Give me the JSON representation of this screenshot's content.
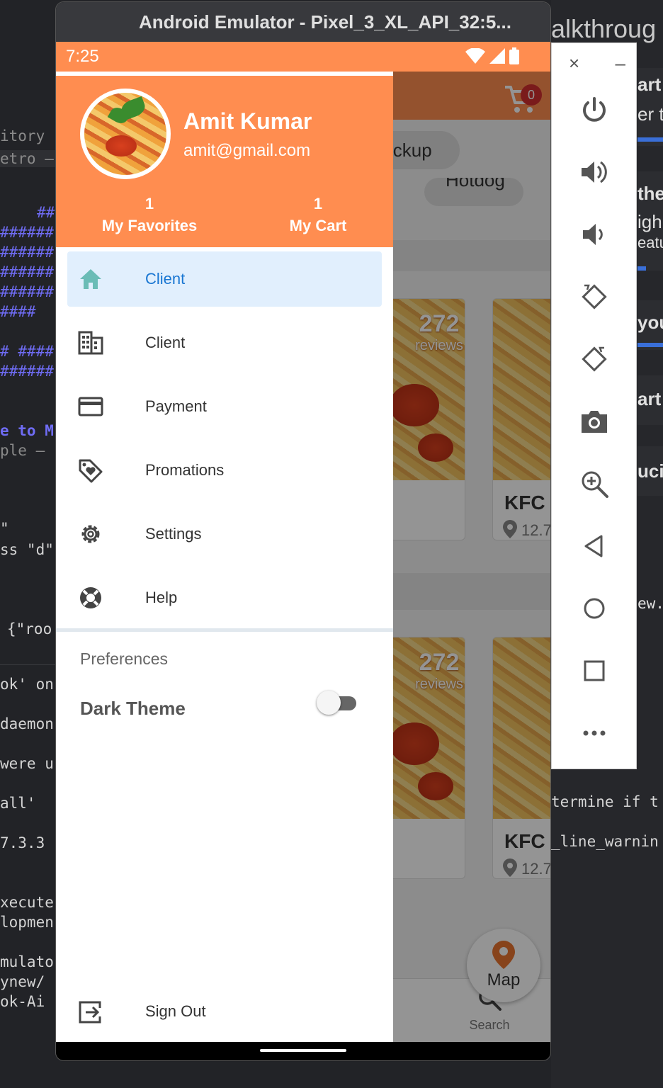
{
  "emulator": {
    "title": "Android Emulator - Pixel_3_XL_API_32:5..."
  },
  "status_bar": {
    "time": "7:25"
  },
  "drawer": {
    "user_name": "Amit Kumar",
    "user_email": "amit@gmail.com",
    "favorites_count": "1",
    "favorites_label": "My Favorites",
    "cart_count": "1",
    "cart_label": "My Cart",
    "items": [
      {
        "label": "Client",
        "icon": "home-icon",
        "active": true
      },
      {
        "label": "Client",
        "icon": "building-icon",
        "active": false
      },
      {
        "label": "Payment",
        "icon": "credit-card-icon",
        "active": false
      },
      {
        "label": "Promations",
        "icon": "tag-heart-icon",
        "active": false
      },
      {
        "label": "Settings",
        "icon": "gear-icon",
        "active": false
      },
      {
        "label": "Help",
        "icon": "lifebuoy-icon",
        "active": false
      }
    ],
    "preferences_title": "Preferences",
    "dark_theme_label": "Dark Theme",
    "dark_theme_enabled": false,
    "sign_out_label": "Sign Out"
  },
  "app": {
    "cart_badge": "0",
    "chip_pickup": "ickup",
    "chip_hotdog": "Hotdog",
    "cards": [
      {
        "reviews_count": "272",
        "reviews_label": "reviews"
      },
      {
        "name": "KFC",
        "distance": "12.7"
      },
      {
        "reviews_count": "272",
        "reviews_label": "reviews"
      },
      {
        "name": "KFC",
        "distance": "12.7"
      }
    ],
    "map_button": "Map",
    "search_tab": "Search"
  },
  "background": {
    "right_title": "alkthroug",
    "lines_left": [
      "itory",
      "etro —",
      "##",
      "######",
      "######",
      "######",
      "######",
      "####",
      "# ####",
      "######",
      "e to M",
      "ple —",
      "\"",
      "ss \"d\"",
      "{\"roo",
      "ok' on",
      "daemon",
      "were u",
      "all' ",
      "7.3.3",
      "xecute",
      "lopmen",
      "mulato",
      "ynew/",
      "ok-Ai"
    ],
    "lines_right": [
      "art",
      "er t",
      "the",
      "igh",
      "eatu",
      "you",
      "art",
      "uci",
      "ew.",
      "termine if t",
      "_line_warnin"
    ]
  },
  "colors": {
    "accent": "#ff8d50",
    "active_bg": "#e1effd",
    "active_text": "#1976d2",
    "badge": "#d32f2f"
  }
}
